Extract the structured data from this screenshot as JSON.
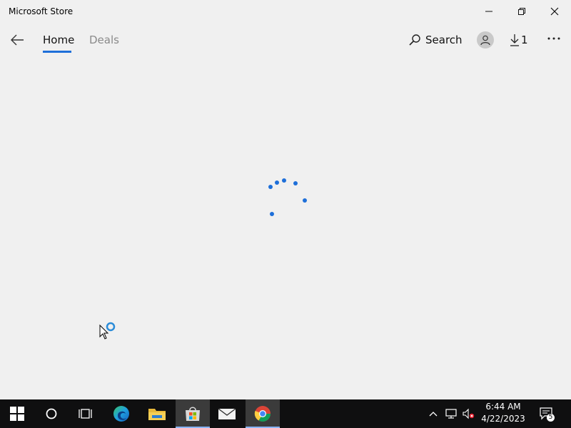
{
  "window": {
    "title": "Microsoft Store"
  },
  "nav": {
    "tabs": [
      {
        "label": "Home",
        "active": true
      },
      {
        "label": "Deals",
        "active": false
      }
    ],
    "search_label": "Search",
    "downloads_count": "1"
  },
  "taskbar": {
    "pinned": [
      {
        "name": "start-icon"
      },
      {
        "name": "cortana-icon"
      },
      {
        "name": "task-view-icon"
      },
      {
        "name": "edge-icon"
      },
      {
        "name": "file-explorer-icon"
      },
      {
        "name": "microsoft-store-icon",
        "active": true
      },
      {
        "name": "mail-icon"
      },
      {
        "name": "chrome-icon",
        "active": true
      }
    ],
    "tray": {
      "time": "6:44 AM",
      "date": "4/22/2023",
      "notification_count": "5"
    }
  },
  "colors": {
    "accent": "#1e6fd9",
    "background": "#f0f0f0",
    "taskbar": "#0f0f10"
  }
}
